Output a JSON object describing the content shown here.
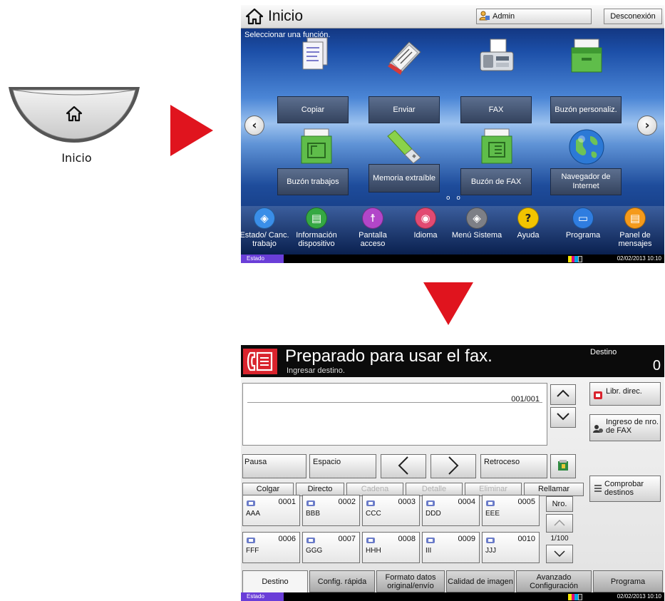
{
  "home_key": {
    "label": "Inicio"
  },
  "home_screen": {
    "title": "Inicio",
    "admin_label": "Admin",
    "logout_label": "Desconexión",
    "subtitle": "Seleccionar una función.",
    "functions": [
      {
        "label": "Copiar",
        "icon": "copy-icon"
      },
      {
        "label": "Enviar",
        "icon": "send-icon"
      },
      {
        "label": "FAX",
        "icon": "fax-icon"
      },
      {
        "label": "Buzón personaliz.",
        "icon": "custom-box-icon"
      },
      {
        "label": "Buzón trabajos",
        "icon": "job-box-icon"
      },
      {
        "label": "Memoria extraíble",
        "icon": "usb-icon"
      },
      {
        "label": "Buzón de FAX",
        "icon": "fax-box-icon"
      },
      {
        "label": "Navegador de Internet",
        "icon": "globe-icon"
      }
    ],
    "page_dots": "o o",
    "dock": [
      {
        "label": "Estado/ Canc. trabajo",
        "color": "#3a8ee8"
      },
      {
        "label": "Información dispositivo",
        "color": "#35a843"
      },
      {
        "label": "Pantalla acceso",
        "color": "#b246c9"
      },
      {
        "label": "Idioma",
        "color": "#e24a72"
      },
      {
        "label": "Menú Sistema",
        "color": "#7d7f86"
      },
      {
        "label": "Ayuda",
        "color": "#f2c400"
      },
      {
        "label": "Programa",
        "color": "#2f7de0"
      },
      {
        "label": "Panel de mensajes",
        "color": "#f59a1b"
      }
    ],
    "status": {
      "tab": "Estado",
      "datetime": "02/02/2013 10:10"
    }
  },
  "fax_screen": {
    "title": "Preparado para usar el fax.",
    "subtitle": "Ingresar destino.",
    "dest_label": "Destino",
    "dest_count": "0",
    "counter": "001/001",
    "pause": "Pausa",
    "space": "Espacio",
    "backspace": "Retroceso",
    "address_book": "Libr. direc.",
    "fax_entry": "Ingreso de nro. de FAX",
    "check_dest": "Comprobar destinos",
    "actions": [
      "Colgar",
      "Directo",
      "Cadena",
      "Detalle",
      "Eliminar",
      "Rellamar"
    ],
    "entries": [
      {
        "num": "0001",
        "name": "AAA"
      },
      {
        "num": "0002",
        "name": "BBB"
      },
      {
        "num": "0003",
        "name": "CCC"
      },
      {
        "num": "0004",
        "name": "DDD"
      },
      {
        "num": "0005",
        "name": "EEE"
      },
      {
        "num": "0006",
        "name": "FFF"
      },
      {
        "num": "0007",
        "name": "GGG"
      },
      {
        "num": "0008",
        "name": "HHH"
      },
      {
        "num": "0009",
        "name": "III"
      },
      {
        "num": "0010",
        "name": "JJJ"
      }
    ],
    "nro_label": "Nro.",
    "page_indicator": "1/100",
    "tabs": [
      "Destino",
      "Config. rápida",
      "Formato datos original/envío",
      "Calidad de imagen",
      "Avanzado Configuración",
      "Programa"
    ],
    "status": {
      "tab": "Estado",
      "datetime": "02/02/2013 10:10"
    }
  }
}
